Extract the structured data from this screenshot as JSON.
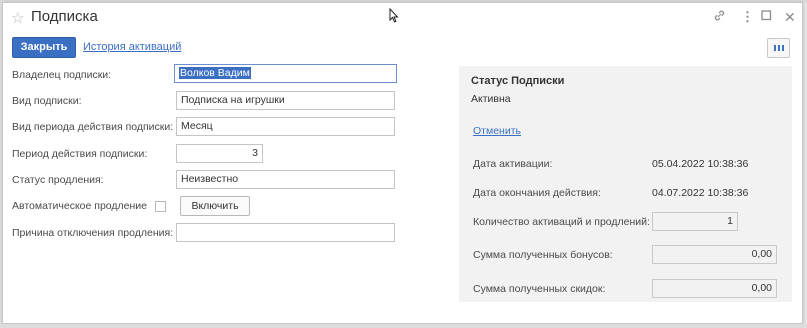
{
  "window": {
    "title": "Подписка"
  },
  "toolbar": {
    "close_label": "Закрыть",
    "history_link": "История активаций"
  },
  "form": {
    "owner": {
      "label": "Владелец подписки:",
      "value": "Волков Вадим"
    },
    "type": {
      "label": "Вид подписки:",
      "value": "Подписка на игрушки"
    },
    "period_kind": {
      "label": "Вид периода действия подписки:",
      "value": "Месяц"
    },
    "period": {
      "label": "Период действия подписки:",
      "value": "3"
    },
    "renewal_status": {
      "label": "Статус продления:",
      "value": "Неизвестно"
    },
    "auto_renewal": {
      "label": "Автоматическое продление",
      "button_label": "Включить"
    },
    "disable_reason": {
      "label": "Причина отключения продления:",
      "value": ""
    }
  },
  "panel": {
    "title": "Статус Подписки",
    "status": "Активна",
    "cancel_link": "Отменить",
    "activation_date": {
      "label": "Дата активации:",
      "value": "05.04.2022 10:38:36"
    },
    "end_date": {
      "label": "Дата окончания действия:",
      "value": "04.07.2022 10:38:36"
    },
    "activations_count": {
      "label": "Количество активаций и продлений:",
      "value": "1"
    },
    "bonuses_sum": {
      "label": "Сумма полученных бонусов:",
      "value": "0,00"
    },
    "discounts_sum": {
      "label": "Сумма полученных скидок:",
      "value": "0,00"
    }
  },
  "icons": {
    "favorite": "star-icon",
    "link": "link-icon",
    "more": "more-vertical-icon",
    "maximize": "maximize-icon",
    "close": "close-icon",
    "columns": "columns-icon"
  },
  "colors": {
    "accent": "#3a6fc4",
    "panel_bg": "#f2f2f2"
  }
}
